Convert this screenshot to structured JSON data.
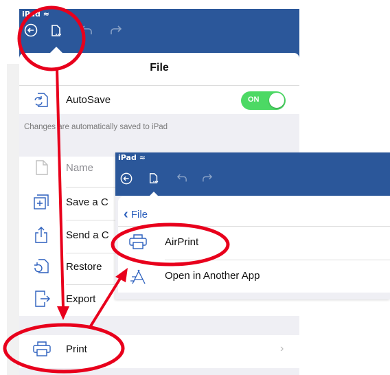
{
  "back_screen": {
    "status_bar": {
      "device": "iPad"
    },
    "panel": {
      "title": "File",
      "autosave": {
        "label": "AutoSave",
        "toggle_state": "ON"
      },
      "hint": "Changes are automatically saved to iPad",
      "items": [
        {
          "label": "Name",
          "icon": "document-icon"
        },
        {
          "label": "Save a C",
          "icon": "plus-box-icon"
        },
        {
          "label": "Send a C",
          "icon": "share-icon"
        },
        {
          "label": "Restore",
          "icon": "restore-icon"
        },
        {
          "label": "Export",
          "icon": "export-icon"
        }
      ],
      "print": {
        "label": "Print",
        "icon": "printer-icon"
      }
    }
  },
  "front_screen": {
    "status_bar": {
      "device": "iPad"
    },
    "back_label": "File",
    "items": [
      {
        "label": "AirPrint",
        "icon": "printer-icon"
      },
      {
        "label": "Open in Another App",
        "icon": "app-store-icon"
      }
    ]
  },
  "colors": {
    "toolbar": "#2b579a",
    "annotation": "#e8001c",
    "toggle_on": "#4cd964",
    "link": "#2b5fbd"
  }
}
